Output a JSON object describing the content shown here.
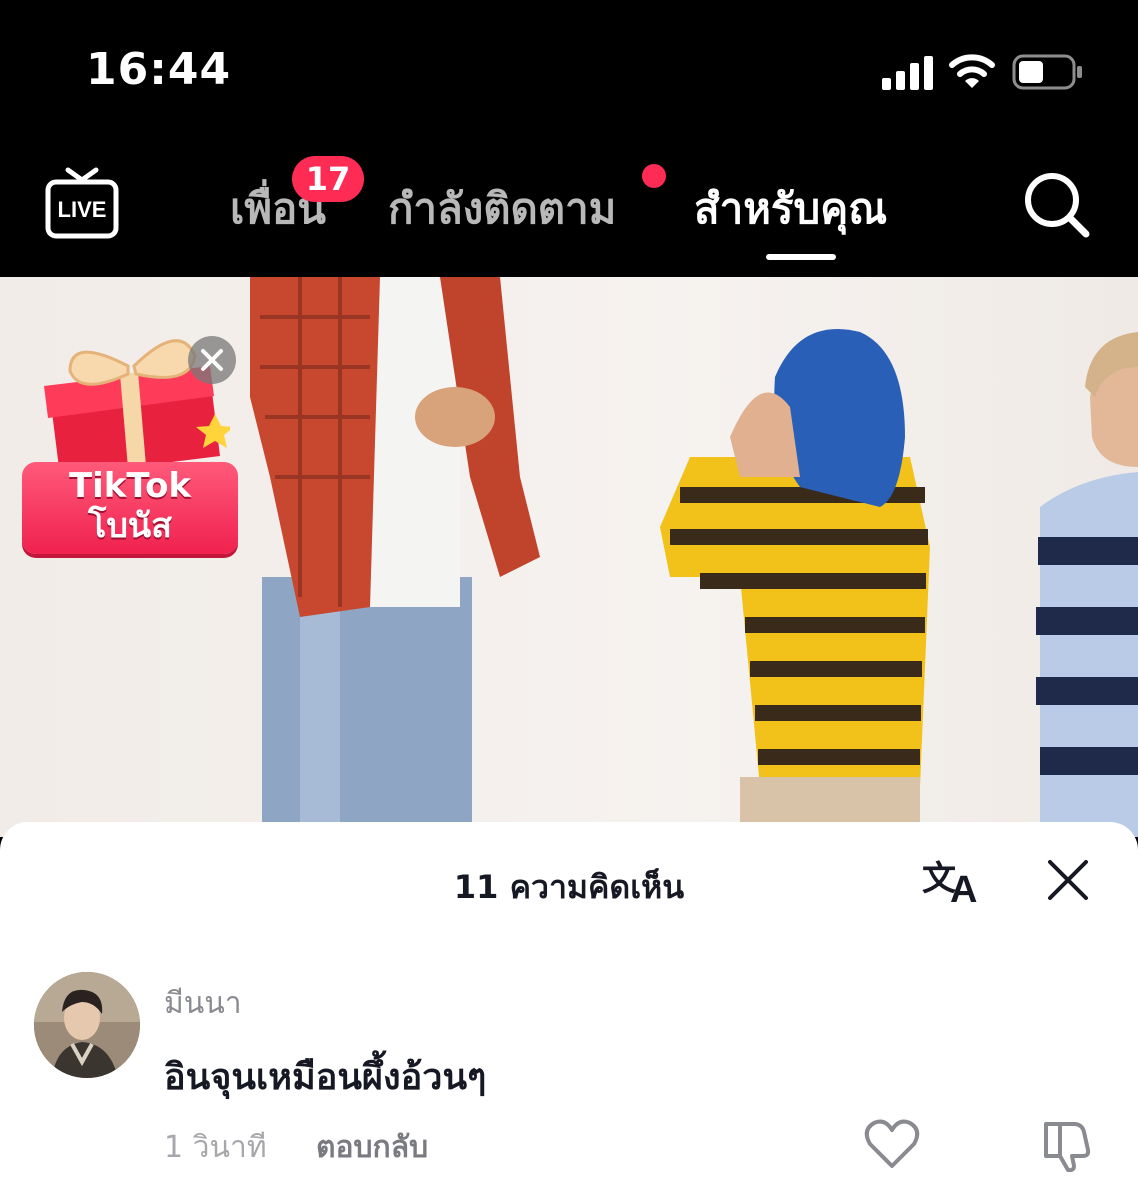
{
  "status_bar": {
    "time": "16:44"
  },
  "nav": {
    "live_label": "LIVE",
    "tabs": [
      {
        "label": "เพื่อน",
        "badge": "17"
      },
      {
        "label": "กำลังติดตาม",
        "has_dot": true
      },
      {
        "label": "สำหรับคุณ",
        "active": true
      }
    ]
  },
  "bonus": {
    "title": "TikTok",
    "subtitle": "โบนัส"
  },
  "comments": {
    "header": "11 ความคิดเห็น",
    "items": [
      {
        "username": "มีนนา",
        "text": "อินจุนเหมือนผึ้งอ้วนๆ",
        "time": "1 วินาที",
        "reply_label": "ตอบกลับ"
      }
    ]
  },
  "colors": {
    "accent": "#fe2c55",
    "background": "#000000",
    "sheet": "#ffffff"
  }
}
